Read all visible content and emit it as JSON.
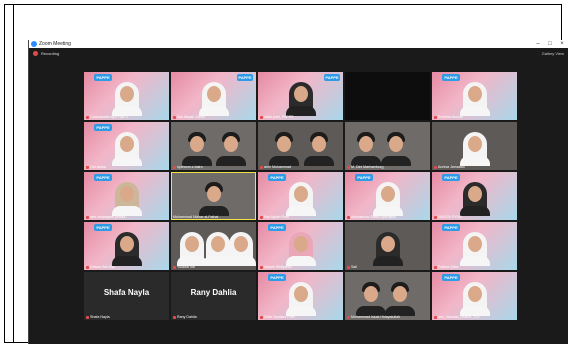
{
  "window": {
    "title": "Zoom Meeting",
    "recording_label": "Recording",
    "gallery_view_label": "Gallery View"
  },
  "tiles": [
    {
      "name": "Commander Ayu Fiya S",
      "badge": "PAPPE"
    },
    {
      "name": "Nur Aisyah Zahra",
      "badge": "PAPPE"
    },
    {
      "name": "erika putri_PAPPE",
      "badge": "PAPPE"
    },
    {
      "name": "",
      "badge": ""
    },
    {
      "name": "Tasbia Ruzaima_PAPPE_UNIDA_Jawa...",
      "badge": ""
    },
    {
      "name": "Ervelina Annisa",
      "badge": "PAPPE"
    },
    {
      "name": "Cici Asma",
      "badge": "PAPPE"
    },
    {
      "name": "syahrom.z.bairo",
      "badge": ""
    },
    {
      "name": "amir Muhammad",
      "badge": ""
    },
    {
      "name": "M. Dini Marhamburg",
      "badge": ""
    },
    {
      "name": "Annisa Jamaatul",
      "badge": ""
    },
    {
      "name": "ann umarajanti jumdul",
      "badge": "PAPPE"
    },
    {
      "name": "Muhammad Nizhar al-Fathal",
      "badge": ""
    },
    {
      "name": "Nur Aqilah Putri",
      "badge": "PAPPE"
    },
    {
      "name": "Aminaturus Sakia Syauqaini",
      "badge": "PAPPE"
    },
    {
      "name": "NASON SYMA",
      "badge": "PAPPE"
    },
    {
      "name": "Dessia Sari Ayu",
      "badge": "PAPPE"
    },
    {
      "name": "Yuliana Siti",
      "badge": ""
    },
    {
      "name": "Aisyah Widiyanto",
      "badge": "PAPPE"
    },
    {
      "name": "Sali",
      "badge": ""
    },
    {
      "name": "Fatima Qifari",
      "badge": "PAPPE"
    },
    {
      "name": "Shafa Nayla",
      "badge": "",
      "big": "Shafa Nayla"
    },
    {
      "name": "Rany Dahlia",
      "badge": "",
      "big": "Rany Dahlia"
    },
    {
      "name": "Della Septiani Putri",
      "badge": "PAPPE"
    },
    {
      "name": "Muhammad Iskak Hidayatullah",
      "badge": ""
    },
    {
      "name": "aris_hambali_UNIDA_102",
      "badge": "PAPPE"
    }
  ]
}
